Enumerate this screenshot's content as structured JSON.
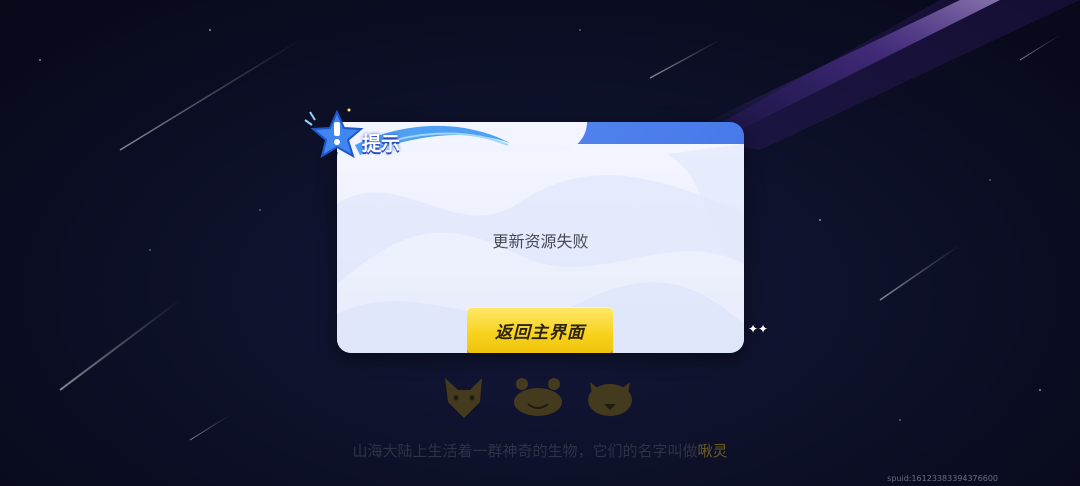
{
  "dialog": {
    "title": "提示",
    "message": "更新资源失败",
    "confirm_label": "返回主界面"
  },
  "footer": {
    "tagline": "山海大陆上生活着一群神奇的生物，它们的名字叫做",
    "tagline_highlight": "啾灵",
    "build_id": "spuid:16123383394376600"
  },
  "icons": {
    "badge": "exclamation-star-icon",
    "creatures": [
      "fox-creature-icon",
      "crab-creature-icon",
      "pig-creature-icon"
    ],
    "sparkle": "sparkle-icon"
  },
  "colors": {
    "accent": "#3e6fe6",
    "button": "#f7d21c",
    "background": "#0c0f26"
  }
}
